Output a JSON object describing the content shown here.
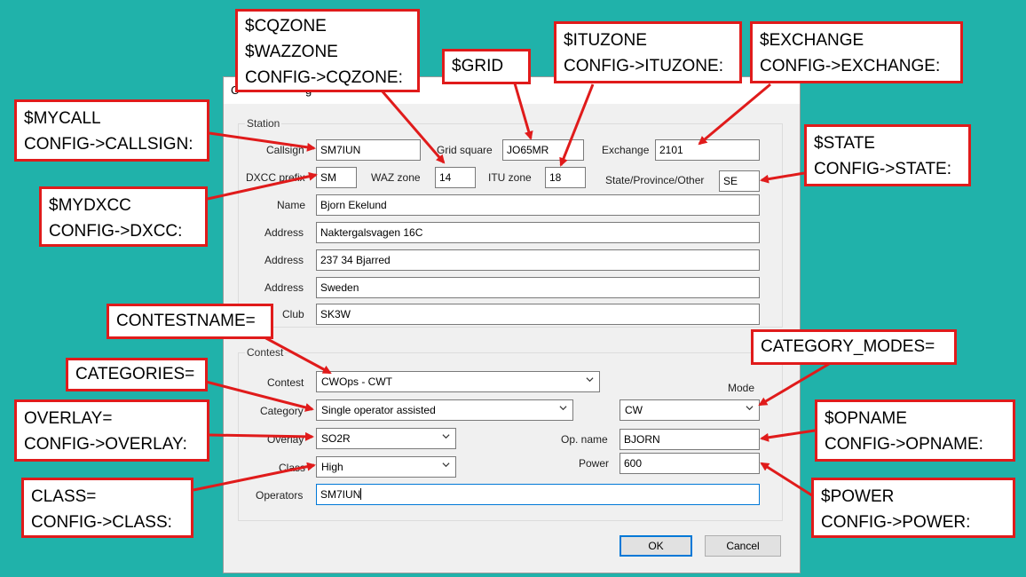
{
  "dialog": {
    "title": "C",
    "title_trailing": "g",
    "station": {
      "group_label": "Station",
      "callsign_label": "Callsign",
      "callsign": "SM7IUN",
      "grid_label": "Grid square",
      "grid": "JO65MR",
      "exchange_label": "Exchange",
      "exchange": "2101",
      "dxcc_label": "DXCC prefix",
      "dxcc": "SM",
      "waz_label": "WAZ zone",
      "waz": "14",
      "itu_label": "ITU zone",
      "itu": "18",
      "state_label": "State/Province/Other",
      "state": "SE",
      "name_label": "Name",
      "name": "Bjorn Ekelund",
      "address_label": "Address",
      "address1": "Naktergalsvagen 16C",
      "address2": "237 34 Bjarred",
      "address3": "Sweden",
      "club_label": "Club",
      "club": "SK3W"
    },
    "contest": {
      "group_label": "Contest",
      "contest_label": "Contest",
      "contest": "CWOps - CWT",
      "mode_label": "Mode",
      "category_label": "Category",
      "category": "Single operator assisted",
      "mode": "CW",
      "overlay_label": "Overlay",
      "overlay": "SO2R",
      "opname_label": "Op. name",
      "opname": "BJORN",
      "class_label": "Class",
      "class": "High",
      "power_label": "Power",
      "power": "600",
      "operators_label": "Operators",
      "operators": "SM7IUN"
    },
    "ok_label": "OK",
    "cancel_label": "Cancel"
  },
  "callouts": {
    "cqzone": [
      "$CQZONE",
      "$WAZZONE",
      "CONFIG->CQZONE:"
    ],
    "grid": [
      "$GRID"
    ],
    "ituzone": [
      "$ITUZONE",
      "CONFIG->ITUZONE:"
    ],
    "exchange": [
      "$EXCHANGE",
      "CONFIG->EXCHANGE:"
    ],
    "mycall": [
      "$MYCALL",
      "CONFIG->CALLSIGN:"
    ],
    "state": [
      "$STATE",
      "CONFIG->STATE:"
    ],
    "mydxcc": [
      "$MYDXCC",
      "CONFIG->DXCC:"
    ],
    "contestname": [
      "CONTESTNAME="
    ],
    "category_modes": [
      "CATEGORY_MODES="
    ],
    "categories": [
      "CATEGORIES="
    ],
    "overlay": [
      "OVERLAY=",
      "CONFIG->OVERLAY:"
    ],
    "opname": [
      "$OPNAME",
      "CONFIG->OPNAME:"
    ],
    "class": [
      "CLASS=",
      "CONFIG->CLASS:"
    ],
    "power": [
      "$POWER",
      "CONFIG->POWER:"
    ]
  },
  "colors": {
    "background": "#20b2aa",
    "callout_border": "#e01b1b",
    "dialog_bg": "#f0f0f0"
  }
}
